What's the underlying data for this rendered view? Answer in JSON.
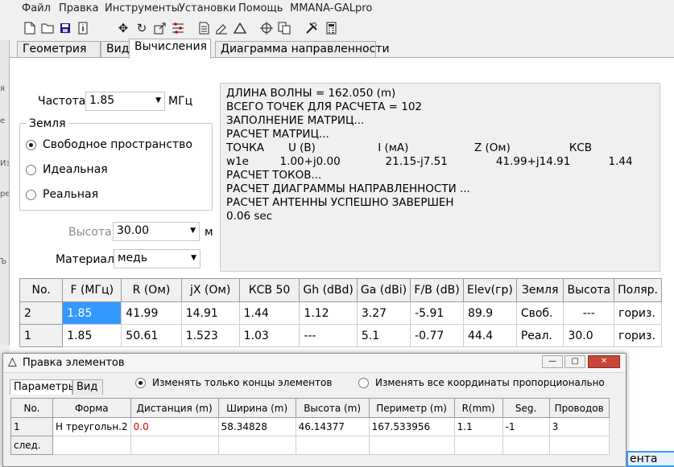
{
  "menu": [
    "Файл",
    "Правка",
    "Инструменты",
    "Установки",
    "Помощь",
    "MMANA-GALpro"
  ],
  "toolbar": [
    "new-file-icon",
    "open-folder-icon",
    "save-icon",
    "info-icon",
    "move-icon",
    "rotate-icon",
    "resize-icon",
    "elements-icon",
    "document-icon",
    "edit-icon",
    "triangle-icon",
    "target-icon",
    "copy-icon",
    "tools-icon",
    "calculator-icon"
  ],
  "left_strip": [
    "я",
    "е",
    "Из",
    "рез",
    "Ъ"
  ],
  "tabs": [
    "Геометрия",
    "Вид",
    "Вычисления",
    "Диаграмма направленности"
  ],
  "active_tab": "Вычисления",
  "freq": {
    "label": "Частота",
    "value": "1.85",
    "unit": "МГц"
  },
  "ground": {
    "title": "Земля",
    "options": [
      "Свободное пространство",
      "Идеальная",
      "Реальная"
    ],
    "selected": "Свободное пространство"
  },
  "height": {
    "label": "Высота",
    "value": "30.00",
    "unit": "м"
  },
  "material": {
    "label": "Материал",
    "value": "медь"
  },
  "log": [
    "ДЛИНА ВОЛНЫ = 162.050 (m)",
    "ВСЕГО ТОЧЕК ДЛЯ РАСЧЕТА = 102",
    "ЗАПОЛНЕНИЕ МАТРИЦ...",
    "РАСЧЕТ МАТРИЦ...",
    "ТОЧКА       U (В)                  I (мА)                   Z (Ом)                 КСВ",
    "w1e         1.00+j0.00             21.15-j7.51              41.99+j14.91           1.44",
    "РАСЧЕТ ТОКОВ...",
    "РАСЧЕТ ДИАГРАММЫ НАПРАВЛЕННОСТИ ...",
    "РАСЧЕТ АНТЕННЫ УСПЕШНО ЗАВЕРШЕН",
    "0.06 sec"
  ],
  "results": {
    "headers": [
      "No.",
      "F (МГц)",
      "R (Ом)",
      "jX (Ом)",
      "КСВ 50",
      "Gh (dBd)",
      "Ga (dBi)",
      "F/B (dB)",
      "Elev(гр)",
      "Земля",
      "Высота",
      "Поляр."
    ],
    "rows": [
      [
        "2",
        "1.85",
        "41.99",
        "14.91",
        "1.44",
        "1.12",
        "3.27",
        "-5.91",
        "89.9",
        "Своб.",
        "---",
        "гориз."
      ],
      [
        "1",
        "1.85",
        "50.61",
        "1.523",
        "1.03",
        "---",
        "5.1",
        "-0.77",
        "44.4",
        "Реал.",
        "30.0",
        "гориз."
      ]
    ]
  },
  "dialog": {
    "title": "Правка элементов",
    "tabs": [
      "Параметры",
      "Вид"
    ],
    "radio_ends": "Изменять только концы элементов",
    "radio_prop": "Изменять все координаты пропорционально",
    "headers": [
      "No.",
      "Форма",
      "Дистанция (m)",
      "Ширина (m)",
      "Высота (m)",
      "Периметр (m)",
      "R(mm)",
      "Seg.",
      "Проводов"
    ],
    "rows": [
      [
        "1",
        "Н треугольн.2",
        "0.0",
        "58.34828",
        "46.14377",
        "167.533956",
        "1.1",
        "-1",
        "3"
      ],
      [
        "след.",
        "",
        "",
        "",
        "",
        "",
        "",
        "",
        ""
      ]
    ]
  },
  "partial_button": "ента",
  "colors": {
    "selection": "#3399ff",
    "close_button": "#c8453a",
    "warning_text": "#e00000"
  }
}
